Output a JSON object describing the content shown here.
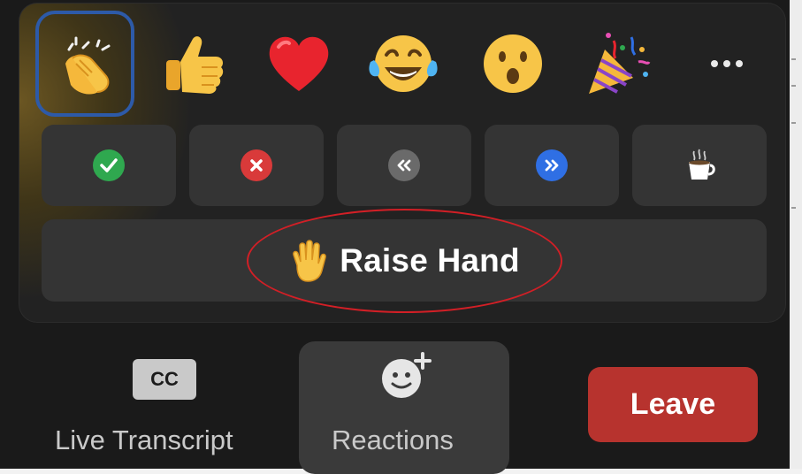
{
  "reactions_panel": {
    "emojis": [
      {
        "name": "clapping-hands",
        "selected": true
      },
      {
        "name": "thumbs-up",
        "selected": false
      },
      {
        "name": "heart",
        "selected": false
      },
      {
        "name": "tears-of-joy",
        "selected": false
      },
      {
        "name": "open-mouth",
        "selected": false
      },
      {
        "name": "party-popper",
        "selected": false
      },
      {
        "name": "more",
        "selected": false
      }
    ],
    "quick_actions": [
      "yes",
      "no",
      "slow-down",
      "speed-up",
      "coffee-break"
    ],
    "raise_hand_label": "Raise Hand"
  },
  "toolbar": {
    "cc_badge": "CC",
    "live_transcript_label": "Live Transcript",
    "reactions_label": "Reactions",
    "leave_label": "Leave"
  },
  "colors": {
    "selection_ring": "#2d5aa8",
    "leave_button": "#b7332e",
    "annotation": "#d21f26",
    "yes_badge": "#2fa84f",
    "no_badge": "#d93a3a",
    "slow_badge": "#6a6a6a",
    "fast_badge": "#2f6fe4"
  }
}
